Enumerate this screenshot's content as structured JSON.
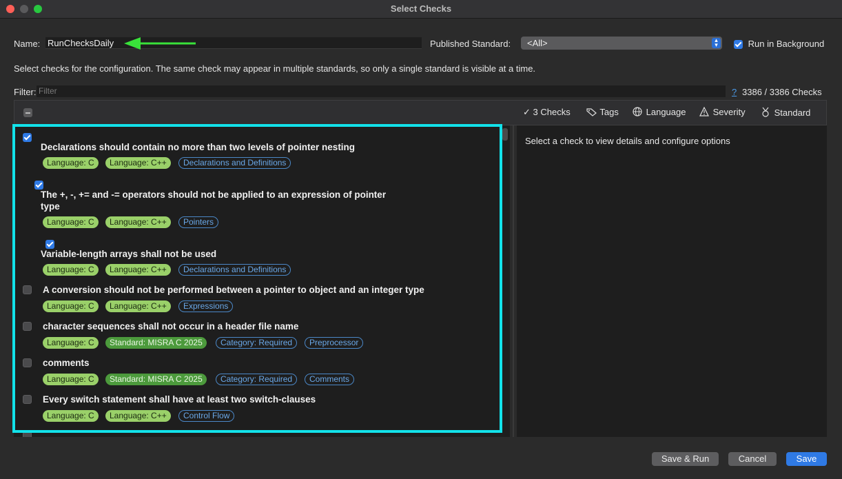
{
  "window": {
    "title": "Select Checks"
  },
  "form": {
    "name_label": "Name:",
    "name_value": "RunChecksDaily",
    "published_standard_label": "Published Standard:",
    "published_standard_value": "<All>",
    "run_in_background_label": "Run in Background",
    "description": "Select checks for the configuration. The same check may appear in multiple standards, so only a single standard is visible at a time.",
    "filter_label": "Filter:",
    "filter_placeholder": "Filter",
    "help_glyph": "?",
    "count": "3386 / 3386 Checks"
  },
  "toolbar": {
    "checks": "3 Checks",
    "tags": "Tags",
    "language": "Language",
    "severity": "Severity",
    "standard": "Standard"
  },
  "checks": [
    {
      "checked": true,
      "title": "Declarations should contain no more than two levels of pointer nesting",
      "tags": [
        "Language: C",
        "Language: C++",
        "Declarations and Definitions"
      ]
    },
    {
      "checked": true,
      "title_line1": "The +, -, += and -= operators should not be applied to an expression of pointer",
      "title_line2": "type",
      "tags": [
        "Language: C",
        "Language: C++",
        "Pointers"
      ]
    },
    {
      "checked": true,
      "title": "Variable-length arrays shall not be used",
      "tags": [
        "Language: C",
        "Language: C++",
        "Declarations and Definitions"
      ]
    },
    {
      "checked": false,
      "title": "A conversion should not be performed between a pointer to object and an integer type",
      "tags": [
        "Language: C",
        "Language: C++",
        "Expressions"
      ]
    },
    {
      "checked": false,
      "title": "character sequences shall not occur in a header file name",
      "tags": [
        "Language: C",
        "Standard: MISRA C 2025",
        "Category: Required",
        "Preprocessor"
      ]
    },
    {
      "checked": false,
      "title": "comments",
      "tags": [
        "Language: C",
        "Standard: MISRA C 2025",
        "Category: Required",
        "Comments"
      ]
    },
    {
      "checked": false,
      "title": "Every switch statement shall have at least two switch-clauses",
      "tags": [
        "Language: C",
        "Language: C++",
        "Control Flow"
      ]
    }
  ],
  "detail": {
    "placeholder": "Select a check to view details and configure options"
  },
  "buttons": {
    "save_run": "Save & Run",
    "cancel": "Cancel",
    "save": "Save"
  },
  "colors": {
    "annotation_arrow": "#39e23a",
    "highlight_box": "#12e2ea",
    "accent": "#2f7ae5"
  }
}
